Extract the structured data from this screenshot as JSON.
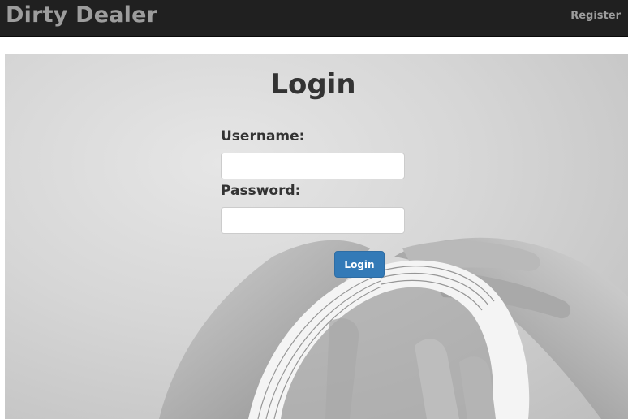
{
  "navbar": {
    "brand": "Dirty Dealer",
    "register_link": "Register"
  },
  "login_form": {
    "title": "Login",
    "username_label": "Username:",
    "username_value": "",
    "password_label": "Password:",
    "password_value": "",
    "submit_label": "Login"
  },
  "colors": {
    "navbar_bg": "#202020",
    "navbar_text": "#9d9d9d",
    "button_primary": "#337ab7",
    "heading_text": "#333333"
  },
  "background": {
    "image": "grayscale photo of hands shuffling a deck of playing cards"
  }
}
